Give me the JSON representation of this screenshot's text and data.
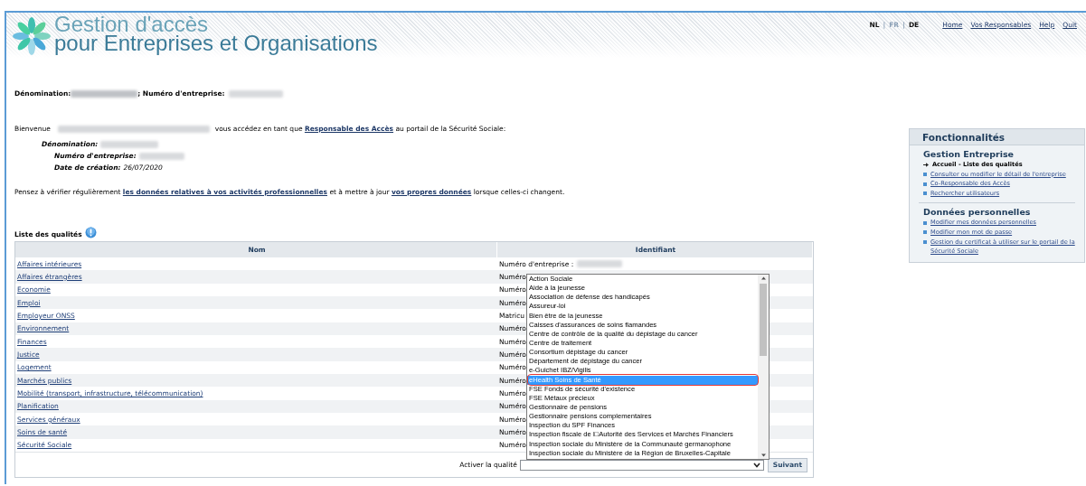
{
  "header": {
    "title_line_1": "Gestion d'accès",
    "title_line_2": "pour Entreprises et Organisations",
    "languages": [
      {
        "label": "NL",
        "selected": false
      },
      {
        "label": "FR",
        "selected": true
      },
      {
        "label": "DE",
        "selected": false
      }
    ],
    "language_separators": [
      "|",
      "|"
    ],
    "links": [
      "Home",
      "Vos Responsables",
      "Help",
      "Quit"
    ]
  },
  "company_line": {
    "label_1": "Dénomination:",
    "label_2": "; Numéro d'entreprise:"
  },
  "welcome": {
    "greeting": "Bienvenue",
    "text_1": "vous accédez en tant que",
    "link": "Responsable des Accès",
    "text_2": "au portail de la Sécurité Sociale:"
  },
  "details": [
    {
      "label": "Dénomination:"
    },
    {
      "label": "Numéro d'entreprise:"
    },
    {
      "label": "Date de création:",
      "value": "26/07/2020"
    }
  ],
  "reminder": {
    "text_1": "Pensez à vérifier régulièrement",
    "link_1": "les données relatives à vos activités professionnelles",
    "text_2": "et à mettre à jour",
    "link_2": "vos propres données",
    "text_3": "lorsque celles-ci changent."
  },
  "qualities": {
    "title": "Liste des qualités",
    "columns": [
      "Nom",
      "Identifiant"
    ],
    "rows": [
      {
        "name": "Affaires intérieures",
        "identifier": "Numéro d'entreprise :",
        "value_blurred": true
      },
      {
        "name": "Affaires étrangères",
        "identifier": "Numéro"
      },
      {
        "name": "Economie",
        "identifier": "Numéro"
      },
      {
        "name": "Emploi",
        "identifier": "Numéro"
      },
      {
        "name": "Employeur ONSS",
        "identifier": "Matricu"
      },
      {
        "name": "Environnement",
        "identifier": "Numéro"
      },
      {
        "name": "Finances",
        "identifier": "Numéro"
      },
      {
        "name": "Justice",
        "identifier": "Numéro"
      },
      {
        "name": "Logement",
        "identifier": "Numéro"
      },
      {
        "name": "Marchés publics",
        "identifier": "Numéro"
      },
      {
        "name": "Mobilité (transport, infrastructure, télécommunication)",
        "identifier": "Numéro"
      },
      {
        "name": "Planification",
        "identifier": "Numéro"
      },
      {
        "name": "Services généraux",
        "identifier": "Numéro"
      },
      {
        "name": "Soins de santé",
        "identifier": "Numéro"
      },
      {
        "name": "Sécurité Sociale",
        "identifier": "Numéro"
      }
    ],
    "activate_label": "Activer la qualité",
    "options": [
      {
        "label": "Action Sociale",
        "selected": false,
        "highlighted": false
      },
      {
        "label": "Aide à la jeunesse",
        "selected": false,
        "highlighted": false
      },
      {
        "label": "Association de défense des handicapés",
        "selected": false,
        "highlighted": false
      },
      {
        "label": "Assureur-loi",
        "selected": false,
        "highlighted": false
      },
      {
        "label": "Bien être de la jeunesse",
        "selected": false,
        "highlighted": false
      },
      {
        "label": "Caisses d'assurances de soins flamandes",
        "selected": false,
        "highlighted": false
      },
      {
        "label": "Centre de contrôle de la qualité du dépistage du cancer",
        "selected": false,
        "highlighted": false
      },
      {
        "label": "Centre de traitement",
        "selected": false,
        "highlighted": false
      },
      {
        "label": "Consortium dépistage du cancer",
        "selected": false,
        "highlighted": false
      },
      {
        "label": "Département de dépistage du cancer",
        "selected": false,
        "highlighted": false
      },
      {
        "label": "e-Guichet IBZ/Vigilis",
        "selected": false,
        "highlighted": false
      },
      {
        "label": "eHealth Soins de Santé",
        "selected": true,
        "highlighted": true
      },
      {
        "label": "FSE Fonds de sécurité d'existence",
        "selected": false,
        "highlighted": false
      },
      {
        "label": "FSE Métaux précieux",
        "selected": false,
        "highlighted": false
      },
      {
        "label": "Gestionnaire de pensions",
        "selected": false,
        "highlighted": false
      },
      {
        "label": "Gestionnaire pensions complementaires",
        "selected": false,
        "highlighted": false
      },
      {
        "label": "Inspection du SPF Finances",
        "selected": false,
        "highlighted": false
      },
      {
        "label": "Inspection fiscale de l□Autorité des Services et Marchés Financiers",
        "selected": false,
        "highlighted": false
      },
      {
        "label": "Inspection sociale du Ministère de la Communauté germanophone",
        "selected": false,
        "highlighted": false
      },
      {
        "label": "Inspection sociale du Ministère de la Région de Bruxelles-Capitale",
        "selected": false,
        "highlighted": false
      }
    ],
    "button": "Suivant"
  },
  "sidebar": {
    "title": "Fonctionnalités",
    "sections": [
      {
        "heading": "Gestion Entreprise",
        "items": [
          {
            "label": "Accueil - Liste des qualités",
            "selected": true
          },
          {
            "label": "Consulter ou modifier le détail de l'entreprise",
            "selected": false
          },
          {
            "label": "Co-Responsable des Accès",
            "selected": false
          },
          {
            "label": "Rechercher utilisateurs",
            "selected": false
          }
        ]
      },
      {
        "heading": "Données personnelles",
        "items": [
          {
            "label": "Modifier mes données personnelles",
            "selected": false
          },
          {
            "label": "Modifier mon mot de passe",
            "selected": false
          },
          {
            "label": "Gestion du certificat à utiliser sur le portail de la Sécurité Sociale",
            "selected": false
          }
        ]
      }
    ]
  }
}
